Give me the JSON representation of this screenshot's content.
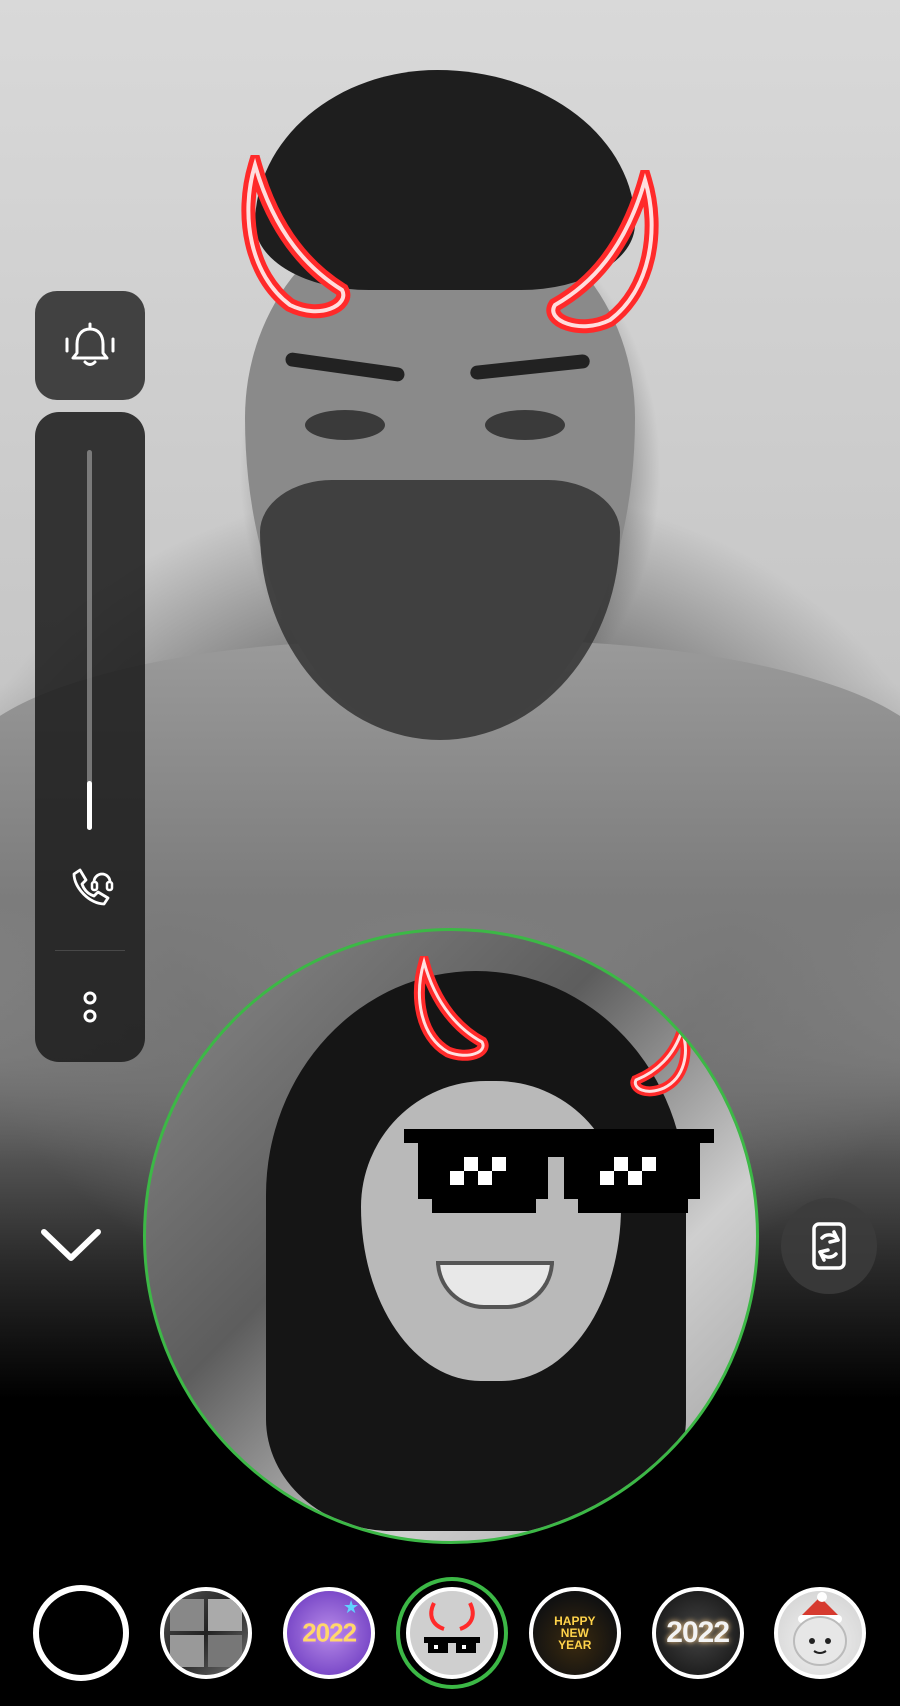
{
  "call": {
    "ringer_icon": "vibrate-bell-icon",
    "volume_level": 0.13,
    "audio_route_icon": "phone-headset-icon",
    "more_icon": "more-vertical-icon",
    "collapse_icon": "chevron-down-icon",
    "switch_camera_icon": "switch-camera-icon"
  },
  "self_view": {
    "ring_color": "#3cb846"
  },
  "lenses": [
    {
      "type": "capture",
      "label": ""
    },
    {
      "type": "photobooth",
      "label": ""
    },
    {
      "type": "year",
      "label": "2022"
    },
    {
      "type": "devil-sunglasses",
      "label": "",
      "selected": true
    },
    {
      "type": "happy-new-year",
      "label": "HAPPY NEW YEAR"
    },
    {
      "type": "year-glow",
      "label": "2022"
    },
    {
      "type": "tiger-santa",
      "label": ""
    }
  ],
  "colors": {
    "horn": "#ff2a2a",
    "accent": "#3cb846"
  }
}
